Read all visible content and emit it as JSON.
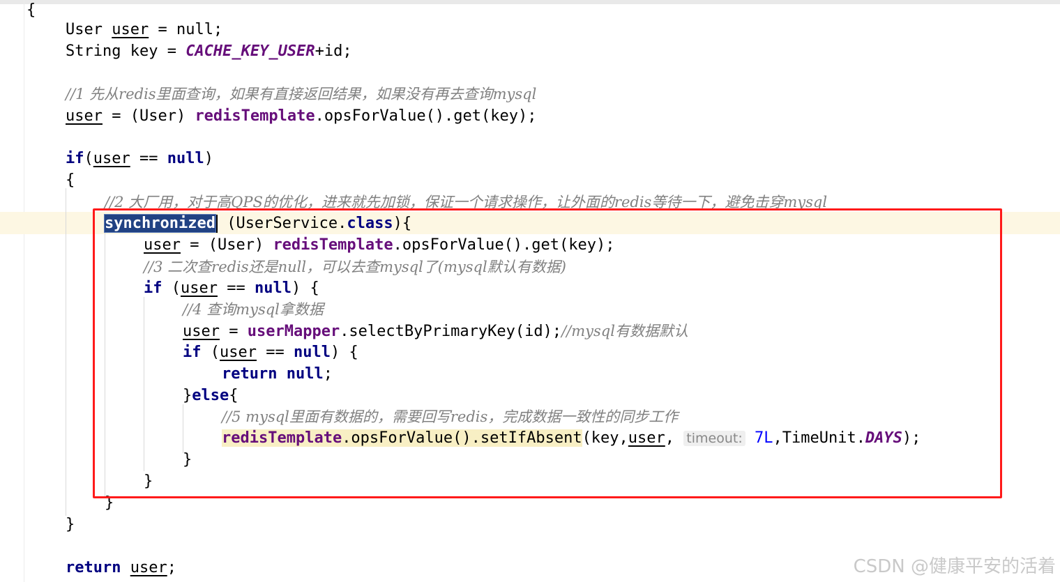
{
  "editor": {
    "l1": [
      "{"
    ],
    "l2": [
      "User ",
      "user",
      " = ",
      "null",
      ";"
    ],
    "l3": [
      "String key = ",
      "CACHE_KEY_USER",
      "+id;"
    ],
    "l5": [
      "//1 先从redis里面查询，如果有直接返回结果，如果没有再去查询mysql"
    ],
    "l6": [
      "user",
      " = (User) ",
      "redisTemplate",
      ".opsForValue().get(key);"
    ],
    "l8": [
      "if",
      "(",
      "user",
      " == ",
      "null",
      ")"
    ],
    "l9": [
      "{"
    ],
    "l10": [
      "//2 大厂用，对于高QPS的优化，进来就先加锁，保证一个请求操作，让外面的redis等待一下，避免击穿mysql"
    ],
    "l11": [
      "synchronized",
      " (UserService.",
      "class",
      "){"
    ],
    "l12": [
      "user",
      " = (User) ",
      "redisTemplate",
      ".opsForValue().get(key);"
    ],
    "l13": [
      "//3 二次查redis还是null，可以去查mysql了(mysql默认有数据)"
    ],
    "l14": [
      "if",
      " (",
      "user",
      " == ",
      "null",
      ") {"
    ],
    "l15": [
      "//4 查询mysql拿数据"
    ],
    "l16": [
      "user",
      " = ",
      "userMapper",
      ".selectByPrimaryKey(id);",
      "//mysql有数据默认"
    ],
    "l17": [
      "if",
      " (",
      "user",
      " == ",
      "null",
      ") {"
    ],
    "l18": [
      "return",
      " ",
      "null",
      ";"
    ],
    "l19": [
      "}",
      "else",
      "{"
    ],
    "l20": [
      "//5 mysql里面有数据的，需要回写redis，完成数据一致性的同步工作"
    ],
    "l21": [
      "redisTemplate",
      ".opsForValue().setIfAbsent",
      "(key,",
      "user",
      ", ",
      "timeout:",
      " ",
      "7L",
      ",TimeUnit.",
      "DAYS",
      ");"
    ],
    "l22": [
      "}"
    ],
    "l23": [
      "}"
    ],
    "l24": [
      "}"
    ],
    "l25": [
      "}"
    ],
    "l27": [
      "return",
      " ",
      "user",
      ";"
    ]
  },
  "colors": {
    "keyword": "#000080",
    "field": "#660e7a",
    "comment": "#808080",
    "number": "#0000ff",
    "selection": "#214283",
    "highlight_box": "#ff1a1a"
  },
  "watermark": "CSDN @健康平安的活着"
}
